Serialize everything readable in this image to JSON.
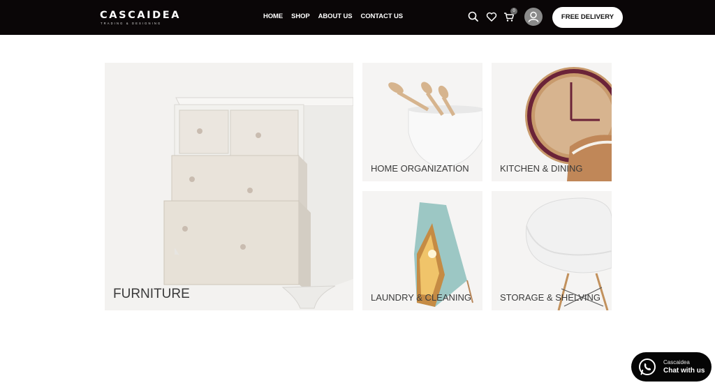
{
  "brand": {
    "name": "CASCAIDEA",
    "tagline": "TRADING & DESIGNING"
  },
  "nav": {
    "items": [
      "HOME",
      "SHOP",
      "ABOUT US",
      "CONTACT US"
    ]
  },
  "header": {
    "cart_count": "0",
    "delivery_label": "FREE DELIVERY"
  },
  "categories": [
    {
      "label": "FURNITURE"
    },
    {
      "label": "HOME ORGANIZATION"
    },
    {
      "label": "KITCHEN & DINING"
    },
    {
      "label": "LAUNDRY & CLEANING"
    },
    {
      "label": "STORAGE & SHELVING"
    }
  ],
  "chat_widget": {
    "name": "Cascaidea",
    "cta": "Chat with us"
  },
  "colors": {
    "header_bg": "#0a0607",
    "tile_bg": "#f4f3f1",
    "chat_bg": "#050505"
  },
  "icons": [
    "search-icon",
    "heart-icon",
    "cart-icon",
    "user-icon",
    "whatsapp-icon"
  ]
}
